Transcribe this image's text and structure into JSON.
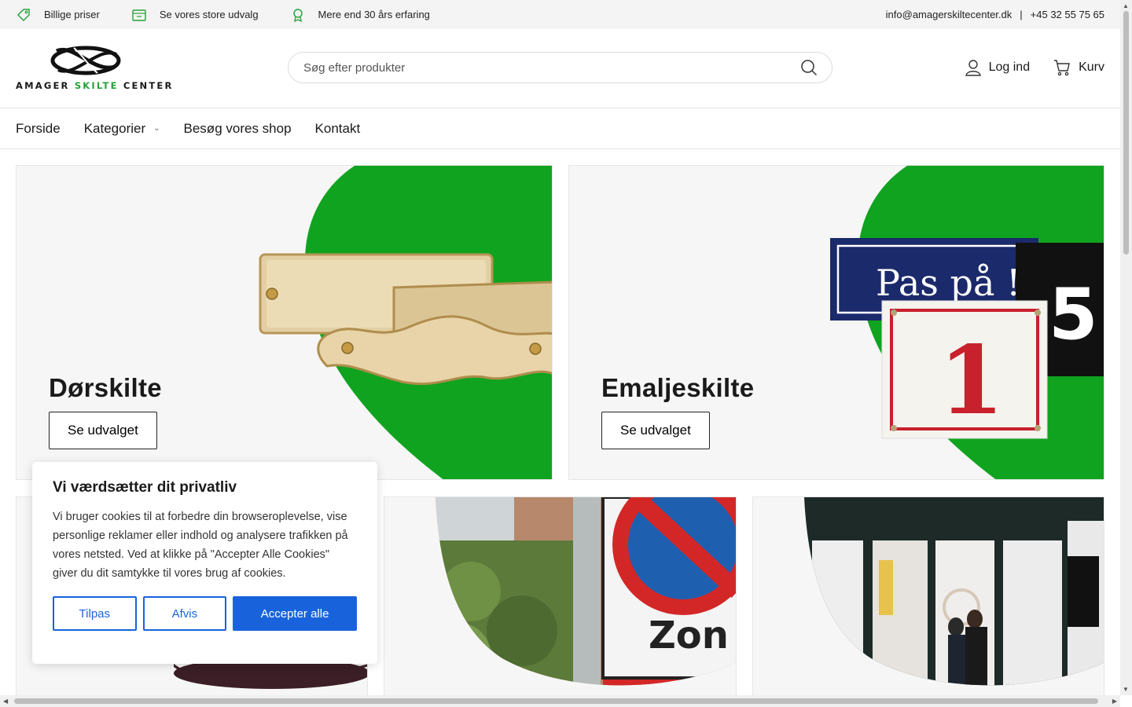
{
  "topbar": {
    "usps": [
      "Billige priser",
      "Se vores store udvalg",
      "Mere end 30 års erfaring"
    ],
    "email": "info@amagerskiltecenter.dk",
    "separator": "|",
    "phone": "+45 32 55 75 65"
  },
  "logo": {
    "word1": "AMAGER",
    "word2": "SKILTE",
    "word3": "CENTER"
  },
  "search": {
    "placeholder": "Søg efter produkter"
  },
  "header": {
    "login_label": "Log ind",
    "cart_label": "Kurv"
  },
  "nav": {
    "items": [
      "Forside",
      "Kategorier",
      "Besøg vores shop",
      "Kontakt"
    ]
  },
  "cards": [
    {
      "title": "Dørskilte",
      "button": "Se udvalget"
    },
    {
      "title": "Emaljeskilte",
      "button": "Se udvalget"
    }
  ],
  "signs": {
    "paspaa": "Pas på !",
    "number": "1",
    "zone": "Zon"
  },
  "cookie": {
    "title": "Vi værdsætter dit privatliv",
    "text": "Vi bruger cookies til at forbedre din browseroplevelse, vise personlige reklamer eller indhold og analysere trafikken på vores netsted. Ved at klikke på \"Accepter Alle Cookies\" giver du dit samtykke til vores brug af cookies.",
    "customize": "Tilpas",
    "reject": "Afvis",
    "accept": "Accepter alle"
  },
  "colors": {
    "brand_green": "#23a135",
    "hero_green": "#10a31f",
    "cookie_blue": "#1863dc"
  }
}
